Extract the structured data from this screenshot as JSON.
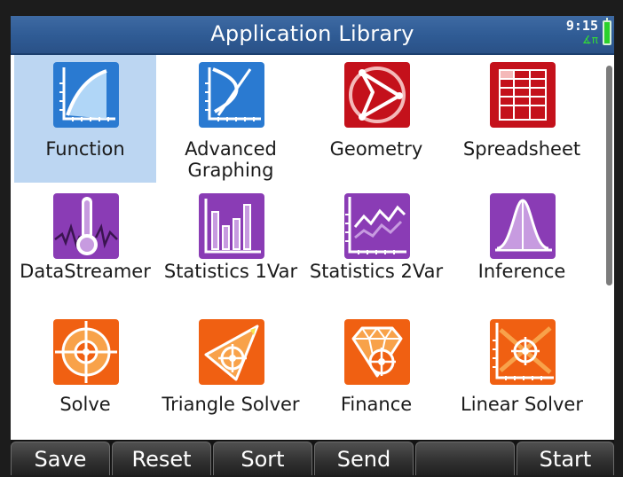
{
  "header": {
    "title": "Application Library",
    "clock": "9:15",
    "angle_indicator": "∡π",
    "battery_icon": "battery-icon"
  },
  "apps": [
    {
      "label_line1": "Function",
      "label_line2": "",
      "icon": "function-app-icon",
      "selected": true
    },
    {
      "label_line1": "Advanced",
      "label_line2": "Graphing",
      "icon": "advanced-graphing-app-icon"
    },
    {
      "label_line1": "Geometry",
      "label_line2": "",
      "icon": "geometry-app-icon"
    },
    {
      "label_line1": "Spreadsheet",
      "label_line2": "",
      "icon": "spreadsheet-app-icon"
    },
    {
      "label_line1": "DataStreamer",
      "label_line2": "",
      "icon": "datastreamer-app-icon"
    },
    {
      "label_line1": "Statistics 1Var",
      "label_line2": "",
      "icon": "statistics-1var-app-icon"
    },
    {
      "label_line1": "Statistics 2Var",
      "label_line2": "",
      "icon": "statistics-2var-app-icon"
    },
    {
      "label_line1": "Inference",
      "label_line2": "",
      "icon": "inference-app-icon"
    },
    {
      "label_line1": "Solve",
      "label_line2": "",
      "icon": "solve-app-icon"
    },
    {
      "label_line1": "Triangle Solver",
      "label_line2": "",
      "icon": "triangle-solver-app-icon"
    },
    {
      "label_line1": "Finance",
      "label_line2": "",
      "icon": "finance-app-icon"
    },
    {
      "label_line1": "Linear Solver",
      "label_line2": "",
      "icon": "linear-solver-app-icon"
    }
  ],
  "softkeys": [
    "Save",
    "Reset",
    "Sort",
    "Send",
    "",
    "Start"
  ],
  "colors": {
    "title_bar": "#2f5b94",
    "selection": "#bcd6f2",
    "function_blue": "#2a7ad1",
    "geometry_red": "#c4111b",
    "stats_purple": "#8a3cb5",
    "solver_orange": "#f06012"
  }
}
